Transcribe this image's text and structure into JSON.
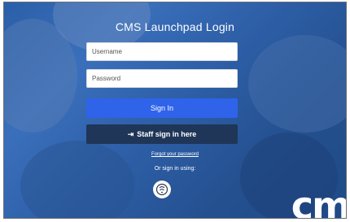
{
  "login": {
    "title": "CMS Launchpad Login",
    "username_placeholder": "Username",
    "password_placeholder": "Password",
    "signin_label": "Sign In",
    "staff_label": "Staff sign in here",
    "forgot_label": "Forgot your password",
    "or_sign_in_label": "Or sign in using:"
  },
  "brand": {
    "logo_text": "cm",
    "accent_color": "#2f63ea",
    "staff_button_color": "#1f3658"
  },
  "icons": {
    "staff": "sign-in-arrow-icon",
    "alternate_signin": "badge-scan-icon"
  }
}
